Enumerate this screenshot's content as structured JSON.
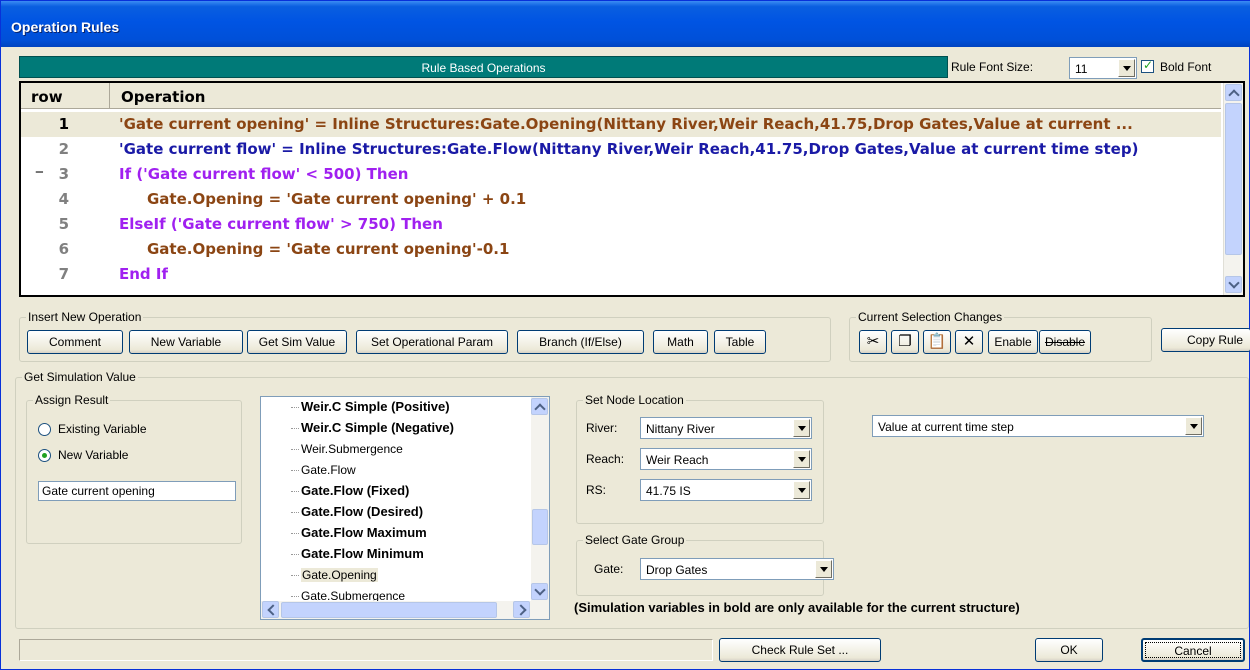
{
  "window": {
    "title": "Operation Rules"
  },
  "header": {
    "banner": "Rule Based Operations",
    "font_size_label": "Rule Font Size:",
    "font_size_value": "11",
    "bold_font_label": "Bold Font",
    "bold_font_checked": true
  },
  "grid": {
    "col_row": "row",
    "col_operation": "Operation",
    "rows": [
      {
        "num": "1",
        "text": "'Gate current opening' = Inline Structures:Gate.Opening(Nittany River,Weir Reach,41.75,Drop Gates,Value at current ...",
        "color": "#8b4513",
        "indent": 0,
        "selected": true
      },
      {
        "num": "2",
        "text": "'Gate current flow' = Inline Structures:Gate.Flow(Nittany River,Weir Reach,41.75,Drop Gates,Value at current time step)",
        "color": "#1a1aa6",
        "indent": 0
      },
      {
        "num": "3",
        "text": "If ('Gate current flow' < 500) Then",
        "color": "#a020f0",
        "indent": 0,
        "collapse": "−"
      },
      {
        "num": "4",
        "text": "Gate.Opening = 'Gate current opening' + 0.1",
        "color": "#8b4513",
        "indent": 1
      },
      {
        "num": "5",
        "text": "ElseIf ('Gate current flow' > 750) Then",
        "color": "#a020f0",
        "indent": 0
      },
      {
        "num": "6",
        "text": "Gate.Opening = 'Gate current opening'-0.1",
        "color": "#8b4513",
        "indent": 1
      },
      {
        "num": "7",
        "text": "End If",
        "color": "#a020f0",
        "indent": 0
      }
    ]
  },
  "insert_group": {
    "label": "Insert New Operation",
    "buttons": [
      "Comment",
      "New Variable",
      "Get Sim Value",
      "Set Operational Param",
      "Branch (If/Else)",
      "Math",
      "Table"
    ]
  },
  "selection_group": {
    "label": "Current Selection Changes",
    "icons": [
      "cut-icon",
      "copy-icon",
      "paste-icon",
      "delete-icon"
    ],
    "enable": "Enable",
    "disable": "Disable"
  },
  "copy_rule": "Copy Rule",
  "sim_group": {
    "label": "Get Simulation Value",
    "assign": {
      "label": "Assign Result",
      "existing": "Existing Variable",
      "new": "New Variable",
      "selected": "new",
      "name_value": "Gate current opening"
    },
    "list_items": [
      {
        "text": "Weir.C Simple (Positive)",
        "bold": true
      },
      {
        "text": "Weir.C Simple (Negative)",
        "bold": true
      },
      {
        "text": "Weir.Submergence",
        "bold": false
      },
      {
        "text": "Gate.Flow",
        "bold": false
      },
      {
        "text": "Gate.Flow (Fixed)",
        "bold": true
      },
      {
        "text": "Gate.Flow (Desired)",
        "bold": true
      },
      {
        "text": "Gate.Flow Maximum",
        "bold": true
      },
      {
        "text": "Gate.Flow Minimum",
        "bold": true
      },
      {
        "text": "Gate.Opening",
        "bold": false,
        "highlight": true
      },
      {
        "text": "Gate.Submergence",
        "bold": false
      }
    ],
    "node": {
      "label": "Set Node Location",
      "river_label": "River:",
      "river_value": "Nittany River",
      "reach_label": "Reach:",
      "reach_value": "Weir Reach",
      "rs_label": "RS:",
      "rs_value": "41.75  IS"
    },
    "gate_group": {
      "label": "Select Gate Group",
      "gate_label": "Gate:",
      "gate_value": "Drop Gates"
    },
    "time_value": "Value at current time step",
    "note": "(Simulation variables in bold are only available for the current structure)"
  },
  "footer": {
    "check": "Check Rule Set ...",
    "ok": "OK",
    "cancel": "Cancel"
  }
}
